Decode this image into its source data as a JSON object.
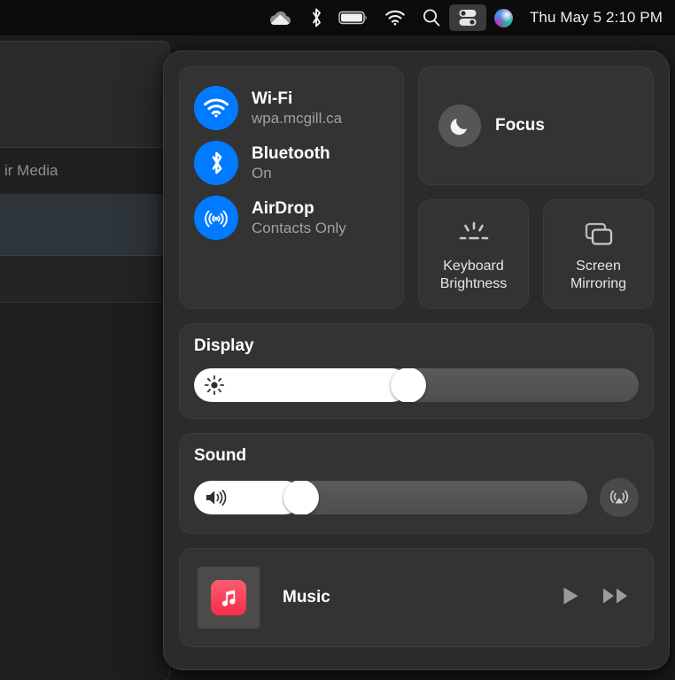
{
  "menubar": {
    "icons": [
      {
        "name": "onedrive-cloud-icon",
        "label": "OneDrive"
      },
      {
        "name": "bluetooth-icon",
        "label": "Bluetooth"
      },
      {
        "name": "battery-icon",
        "label": "Battery"
      },
      {
        "name": "wifi-icon",
        "label": "Wi-Fi"
      },
      {
        "name": "spotlight-search-icon",
        "label": "Spotlight Search"
      },
      {
        "name": "control-center-icon",
        "label": "Control Center"
      },
      {
        "name": "siri-icon",
        "label": "Siri"
      }
    ],
    "clock": "Thu May 5  2:10 PM"
  },
  "background_window": {
    "row_label": "ir Media"
  },
  "control_center": {
    "connectivity": [
      {
        "icon": "wifi-icon",
        "title": "Wi-Fi",
        "subtitle": "wpa.mcgill.ca",
        "color": "#007aff"
      },
      {
        "icon": "bluetooth-icon",
        "title": "Bluetooth",
        "subtitle": "On",
        "color": "#007aff"
      },
      {
        "icon": "airdrop-icon",
        "title": "AirDrop",
        "subtitle": "Contacts Only",
        "color": "#007aff"
      }
    ],
    "focus": {
      "icon": "moon-icon",
      "label": "Focus"
    },
    "tiles": [
      {
        "icon": "keyboard-brightness-icon",
        "label": "Keyboard\nBrightness",
        "line1": "Keyboard",
        "line2": "Brightness"
      },
      {
        "icon": "screen-mirroring-icon",
        "label": "Screen\nMirroring",
        "line1": "Screen",
        "line2": "Mirroring"
      }
    ],
    "display": {
      "title": "Display",
      "icon": "brightness-sun-icon",
      "value_percent": 48
    },
    "sound": {
      "title": "Sound",
      "icon": "speaker-volume-icon",
      "value_percent": 25,
      "airplay": {
        "icon": "airplay-audio-icon",
        "label": "AirPlay"
      }
    },
    "music": {
      "app_icon": "music-app-icon",
      "app_icon_color": "#f62c48",
      "name": "Music",
      "controls": [
        {
          "icon": "play-icon",
          "label": "Play"
        },
        {
          "icon": "fast-forward-icon",
          "label": "Fast Forward"
        }
      ]
    }
  }
}
